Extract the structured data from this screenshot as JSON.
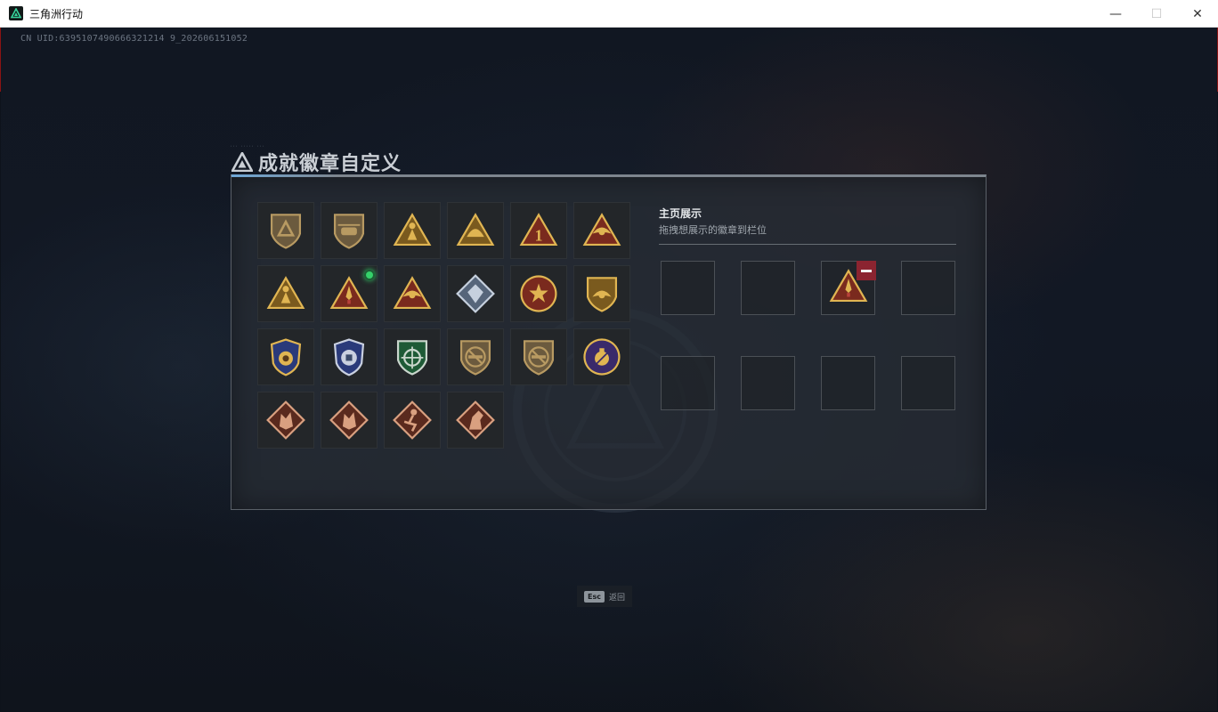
{
  "window": {
    "title": "三角洲行动",
    "minimize_glyph": "—",
    "maximize_glyph": "☐",
    "close_glyph": "✕"
  },
  "uid_text": "CN UID:6395107490666321214 9_202606151052",
  "dialog": {
    "title": "成就徽章自定义",
    "title_icon": "delta-triangle-icon"
  },
  "badges": [
    {
      "name": "delta-shield-badge",
      "palette": "bronze",
      "shape": "shield",
      "glyph": "delta",
      "new": false
    },
    {
      "name": "helicopter-badge",
      "palette": "bronze",
      "shape": "shield",
      "glyph": "heli",
      "new": false
    },
    {
      "name": "soldier-triangle-badge",
      "palette": "gold",
      "shape": "triangle",
      "glyph": "figure",
      "new": false
    },
    {
      "name": "helmet-triangle-badge",
      "palette": "gold",
      "shape": "triangle",
      "glyph": "dome",
      "new": false
    },
    {
      "name": "number-one-badge",
      "palette": "gold-red",
      "shape": "triangle",
      "glyph": "one",
      "new": false
    },
    {
      "name": "eagle-triangle-badge",
      "palette": "gold-red",
      "shape": "triangle",
      "glyph": "wing",
      "new": false
    },
    {
      "name": "squad-triangle-badge",
      "palette": "gold",
      "shape": "triangle",
      "glyph": "figure",
      "new": false
    },
    {
      "name": "rocket-triangle-badge",
      "palette": "gold-red",
      "shape": "triangle",
      "glyph": "rocket",
      "new": true
    },
    {
      "name": "arm-triangle-badge",
      "palette": "gold-red",
      "shape": "triangle",
      "glyph": "wing",
      "new": false
    },
    {
      "name": "crystal-diamond-badge",
      "palette": "silver",
      "shape": "diamond",
      "glyph": "gem",
      "new": false
    },
    {
      "name": "star-medal-badge",
      "palette": "gold-red",
      "shape": "round",
      "glyph": "star",
      "new": false
    },
    {
      "name": "wings-shield-badge",
      "palette": "gold",
      "shape": "shield",
      "glyph": "wing",
      "new": false
    },
    {
      "name": "police-gold-badge",
      "palette": "gold-blue",
      "shape": "police",
      "glyph": "coin",
      "new": false
    },
    {
      "name": "police-silver-badge",
      "palette": "silver-blue",
      "shape": "police",
      "glyph": "fist",
      "new": false
    },
    {
      "name": "crosshair-green-badge",
      "palette": "green",
      "shape": "shield",
      "glyph": "crosshair",
      "new": false
    },
    {
      "name": "no-rifle-badge",
      "palette": "bronze",
      "shape": "shield",
      "glyph": "norifle",
      "new": false
    },
    {
      "name": "no-rifle-badge-2",
      "palette": "bronze",
      "shape": "shield",
      "glyph": "norifle",
      "new": false
    },
    {
      "name": "grenade-purple-badge",
      "palette": "gold-purple",
      "shape": "round",
      "glyph": "grenade",
      "new": false
    },
    {
      "name": "dragon-diamond-badge",
      "palette": "copper",
      "shape": "diamond",
      "glyph": "beast",
      "new": false
    },
    {
      "name": "dragon-diamond-badge-2",
      "palette": "copper",
      "shape": "diamond",
      "glyph": "beast",
      "new": false
    },
    {
      "name": "runner-diamond-badge",
      "palette": "copper",
      "shape": "diamond",
      "glyph": "runner",
      "new": false
    },
    {
      "name": "horse-diamond-badge",
      "palette": "copper",
      "shape": "diamond",
      "glyph": "horse",
      "new": false
    }
  ],
  "showcase": {
    "title": "主页展示",
    "subtitle": "拖拽想展示的徽章到栏位",
    "slots": [
      {
        "filled": false
      },
      {
        "filled": false
      },
      {
        "filled": true,
        "badge": "rocket-triangle-badge",
        "palette": "gold-red",
        "shape": "triangle",
        "glyph": "rocket"
      },
      {
        "filled": false
      },
      {
        "filled": false
      },
      {
        "filled": false
      },
      {
        "filled": false
      },
      {
        "filled": false
      }
    ]
  },
  "footer": {
    "esc_key": "Esc",
    "esc_label": "返回"
  },
  "colors": {
    "accent_blue": "#6fa8d8",
    "remove_red": "#8b2430",
    "new_dot_green": "#35d16a"
  }
}
